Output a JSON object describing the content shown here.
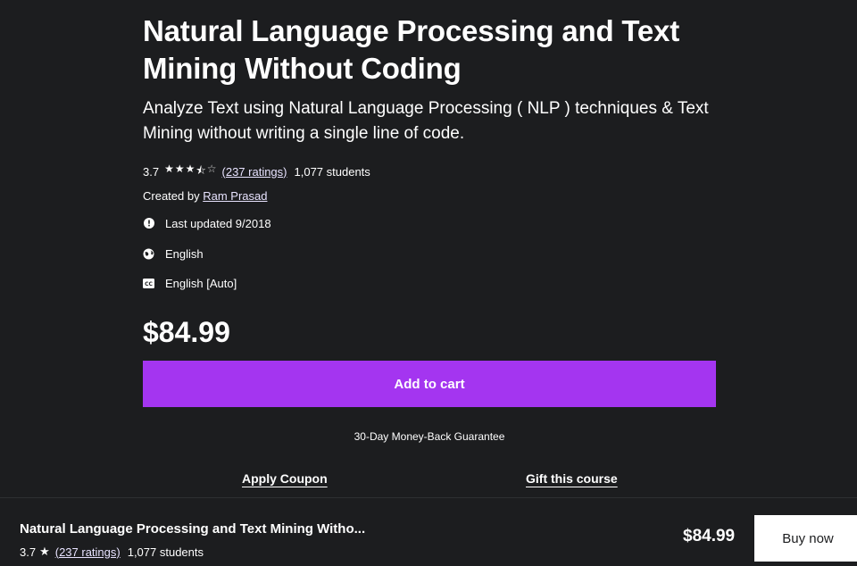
{
  "course": {
    "title": "Natural Language Processing and Text Mining Without Coding",
    "subtitle": "Analyze Text using Natural Language Processing ( NLP ) techniques & Text Mining without writing a single line of code.",
    "rating": "3.7",
    "ratings_link": "(237 ratings)",
    "students": "1,077 students",
    "created_by_label": "Created by",
    "instructor": "Ram Prasad",
    "last_updated": "Last updated 9/2018",
    "language": "English",
    "captions": "English [Auto]",
    "price": "$84.99",
    "add_to_cart": "Add to cart",
    "guarantee": "30-Day Money-Back Guarantee",
    "apply_coupon": "Apply Coupon",
    "gift": "Gift this course"
  },
  "sticky_bar": {
    "title": "Natural Language Processing and Text Mining Witho...",
    "rating": "3.7",
    "ratings_link": "(237 ratings)",
    "students": "1,077 students",
    "price": "$84.99",
    "buy_now": "Buy now"
  },
  "icons": {
    "rating_stars": [
      "star-full",
      "star-full",
      "star-full",
      "star-half",
      "star-empty"
    ],
    "updated": "alert-circle-icon",
    "language": "globe-icon",
    "captions": "closed-captions-icon"
  },
  "colors": {
    "background": "#1c1d1f",
    "accent": "#a435f0",
    "text": "#ffffff"
  }
}
